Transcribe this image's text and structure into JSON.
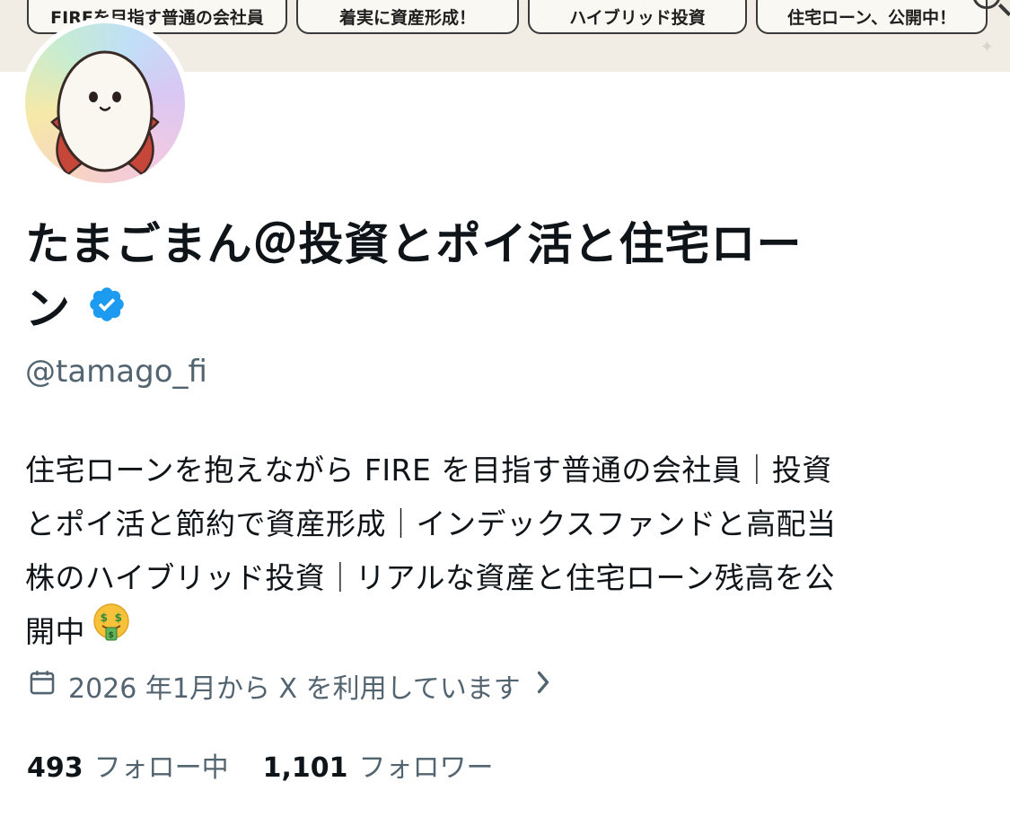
{
  "banner": {
    "tags": [
      "FIREを目指す普通の会社員",
      "着実に資産形成！",
      "ハイブリッド投資",
      "住宅ローン、公開中！"
    ]
  },
  "profile": {
    "name_line1": "たまごまん＠投資とポイ活と住宅ロー",
    "name_line2": "ン",
    "handle": "@tamago_fi",
    "bio_lines": [
      "住宅ローンを抱えながら FIRE を目指す普通の会社員｜投資",
      "とポイ活と節約で資産形成｜インデックスファンドと高配当",
      "株のハイブリッド投資｜リアルな資産と住宅ローン残高を公",
      "開中"
    ],
    "joined_text": "2026 年1月から X を利用しています",
    "following_count": "493",
    "following_label": "フォロー中",
    "followers_count": "1,101",
    "followers_label": "フォロワー"
  },
  "icons": {
    "verified": "verified-badge-icon",
    "calendar": "calendar-icon",
    "chevron": "chevron-right-icon",
    "emoji": "money-mouth-face-emoji"
  },
  "colors": {
    "verified_blue": "#1d9bf0",
    "secondary_text": "#536471",
    "primary_text": "#0f1419",
    "banner_bg": "#f1ece4"
  }
}
